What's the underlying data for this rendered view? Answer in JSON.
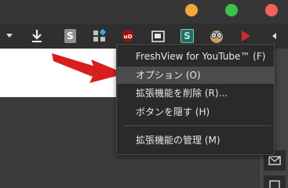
{
  "menu": {
    "items": [
      {
        "label": "FreshView for YouTube™ (F)"
      },
      {
        "label": "オプション (O)"
      },
      {
        "label": "拡張機能を削除 (R)..."
      },
      {
        "label": "ボタンを隠す (H)"
      },
      {
        "label": "拡張機能の管理 (M)"
      }
    ]
  },
  "toolbar": {
    "s_ext_label": "S",
    "s2_ext_label": "S"
  },
  "colors": {
    "menu_bg": "#2a2a2b",
    "highlight": "#4b4b4d",
    "arrow_red": "#d81e1e"
  }
}
